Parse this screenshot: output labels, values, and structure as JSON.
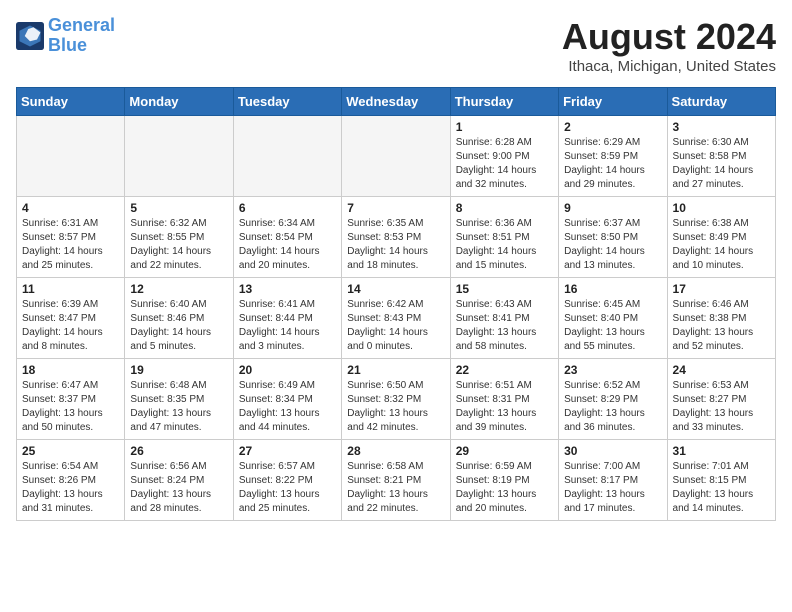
{
  "logo": {
    "text_general": "General",
    "text_blue": "Blue"
  },
  "title": {
    "month_year": "August 2024",
    "location": "Ithaca, Michigan, United States"
  },
  "headers": [
    "Sunday",
    "Monday",
    "Tuesday",
    "Wednesday",
    "Thursday",
    "Friday",
    "Saturday"
  ],
  "weeks": [
    [
      {
        "day": "",
        "info": ""
      },
      {
        "day": "",
        "info": ""
      },
      {
        "day": "",
        "info": ""
      },
      {
        "day": "",
        "info": ""
      },
      {
        "day": "1",
        "info": "Sunrise: 6:28 AM\nSunset: 9:00 PM\nDaylight: 14 hours\nand 32 minutes."
      },
      {
        "day": "2",
        "info": "Sunrise: 6:29 AM\nSunset: 8:59 PM\nDaylight: 14 hours\nand 29 minutes."
      },
      {
        "day": "3",
        "info": "Sunrise: 6:30 AM\nSunset: 8:58 PM\nDaylight: 14 hours\nand 27 minutes."
      }
    ],
    [
      {
        "day": "4",
        "info": "Sunrise: 6:31 AM\nSunset: 8:57 PM\nDaylight: 14 hours\nand 25 minutes."
      },
      {
        "day": "5",
        "info": "Sunrise: 6:32 AM\nSunset: 8:55 PM\nDaylight: 14 hours\nand 22 minutes."
      },
      {
        "day": "6",
        "info": "Sunrise: 6:34 AM\nSunset: 8:54 PM\nDaylight: 14 hours\nand 20 minutes."
      },
      {
        "day": "7",
        "info": "Sunrise: 6:35 AM\nSunset: 8:53 PM\nDaylight: 14 hours\nand 18 minutes."
      },
      {
        "day": "8",
        "info": "Sunrise: 6:36 AM\nSunset: 8:51 PM\nDaylight: 14 hours\nand 15 minutes."
      },
      {
        "day": "9",
        "info": "Sunrise: 6:37 AM\nSunset: 8:50 PM\nDaylight: 14 hours\nand 13 minutes."
      },
      {
        "day": "10",
        "info": "Sunrise: 6:38 AM\nSunset: 8:49 PM\nDaylight: 14 hours\nand 10 minutes."
      }
    ],
    [
      {
        "day": "11",
        "info": "Sunrise: 6:39 AM\nSunset: 8:47 PM\nDaylight: 14 hours\nand 8 minutes."
      },
      {
        "day": "12",
        "info": "Sunrise: 6:40 AM\nSunset: 8:46 PM\nDaylight: 14 hours\nand 5 minutes."
      },
      {
        "day": "13",
        "info": "Sunrise: 6:41 AM\nSunset: 8:44 PM\nDaylight: 14 hours\nand 3 minutes."
      },
      {
        "day": "14",
        "info": "Sunrise: 6:42 AM\nSunset: 8:43 PM\nDaylight: 14 hours\nand 0 minutes."
      },
      {
        "day": "15",
        "info": "Sunrise: 6:43 AM\nSunset: 8:41 PM\nDaylight: 13 hours\nand 58 minutes."
      },
      {
        "day": "16",
        "info": "Sunrise: 6:45 AM\nSunset: 8:40 PM\nDaylight: 13 hours\nand 55 minutes."
      },
      {
        "day": "17",
        "info": "Sunrise: 6:46 AM\nSunset: 8:38 PM\nDaylight: 13 hours\nand 52 minutes."
      }
    ],
    [
      {
        "day": "18",
        "info": "Sunrise: 6:47 AM\nSunset: 8:37 PM\nDaylight: 13 hours\nand 50 minutes."
      },
      {
        "day": "19",
        "info": "Sunrise: 6:48 AM\nSunset: 8:35 PM\nDaylight: 13 hours\nand 47 minutes."
      },
      {
        "day": "20",
        "info": "Sunrise: 6:49 AM\nSunset: 8:34 PM\nDaylight: 13 hours\nand 44 minutes."
      },
      {
        "day": "21",
        "info": "Sunrise: 6:50 AM\nSunset: 8:32 PM\nDaylight: 13 hours\nand 42 minutes."
      },
      {
        "day": "22",
        "info": "Sunrise: 6:51 AM\nSunset: 8:31 PM\nDaylight: 13 hours\nand 39 minutes."
      },
      {
        "day": "23",
        "info": "Sunrise: 6:52 AM\nSunset: 8:29 PM\nDaylight: 13 hours\nand 36 minutes."
      },
      {
        "day": "24",
        "info": "Sunrise: 6:53 AM\nSunset: 8:27 PM\nDaylight: 13 hours\nand 33 minutes."
      }
    ],
    [
      {
        "day": "25",
        "info": "Sunrise: 6:54 AM\nSunset: 8:26 PM\nDaylight: 13 hours\nand 31 minutes."
      },
      {
        "day": "26",
        "info": "Sunrise: 6:56 AM\nSunset: 8:24 PM\nDaylight: 13 hours\nand 28 minutes."
      },
      {
        "day": "27",
        "info": "Sunrise: 6:57 AM\nSunset: 8:22 PM\nDaylight: 13 hours\nand 25 minutes."
      },
      {
        "day": "28",
        "info": "Sunrise: 6:58 AM\nSunset: 8:21 PM\nDaylight: 13 hours\nand 22 minutes."
      },
      {
        "day": "29",
        "info": "Sunrise: 6:59 AM\nSunset: 8:19 PM\nDaylight: 13 hours\nand 20 minutes."
      },
      {
        "day": "30",
        "info": "Sunrise: 7:00 AM\nSunset: 8:17 PM\nDaylight: 13 hours\nand 17 minutes."
      },
      {
        "day": "31",
        "info": "Sunrise: 7:01 AM\nSunset: 8:15 PM\nDaylight: 13 hours\nand 14 minutes."
      }
    ]
  ]
}
